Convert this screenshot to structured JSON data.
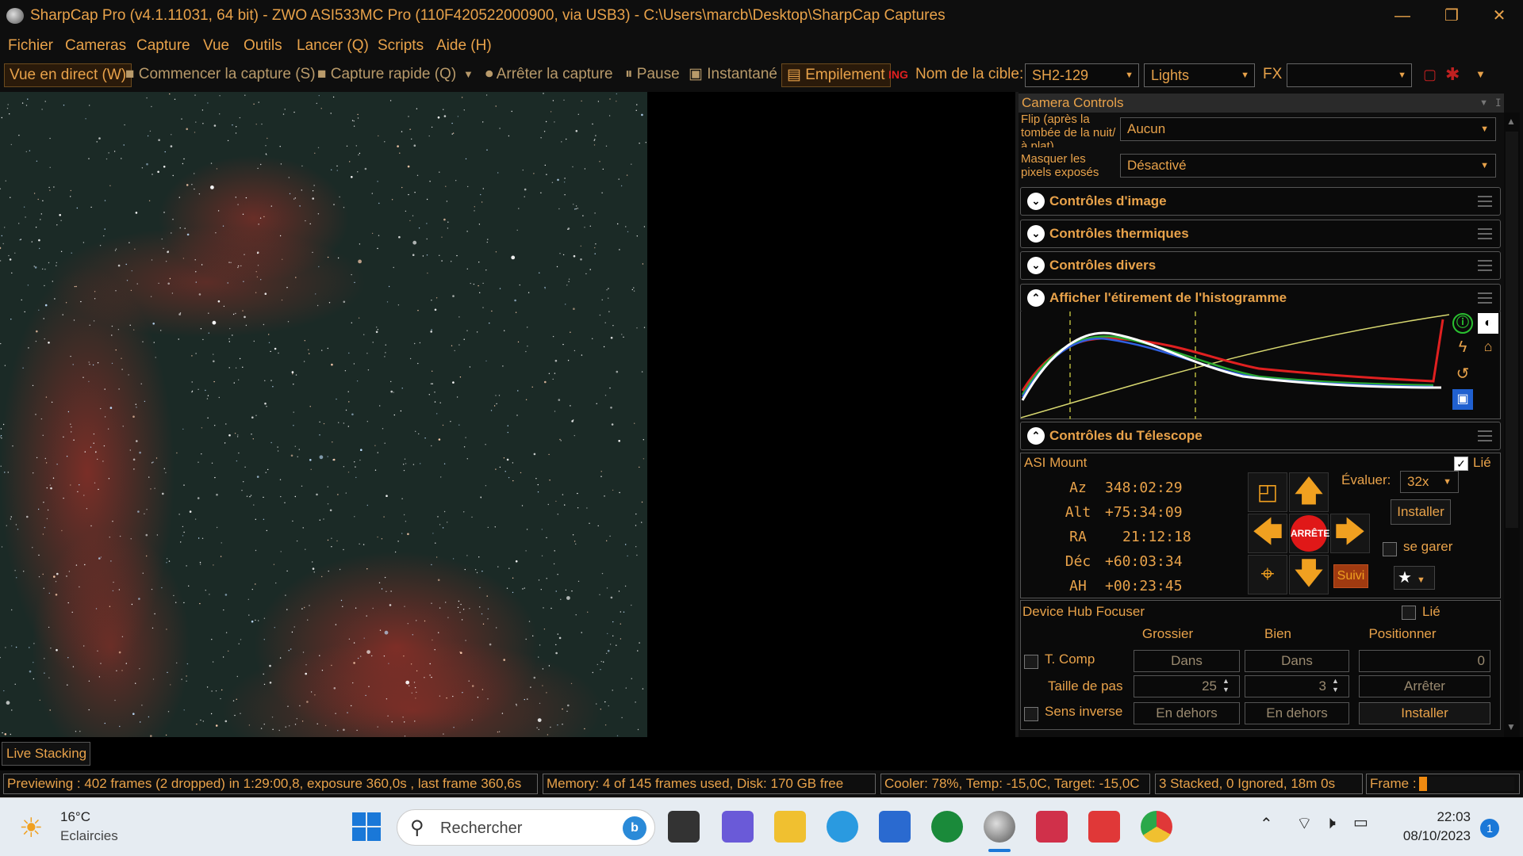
{
  "window": {
    "title": "SharpCap Pro (v4.1.11031, 64 bit) - ZWO ASI533MC Pro (110F420522000900, via USB3) - C:\\Users\\marcb\\Desktop\\SharpCap Captures",
    "minimize": "—",
    "restore": "❐",
    "close": "✕"
  },
  "menu": [
    "Fichier",
    "Cameras",
    "Capture",
    "Vue",
    "Outils",
    "Lancer (Q)",
    "Scripts",
    "Aide (H)"
  ],
  "toolbar": {
    "live_view": "Vue en direct (W)",
    "start_capture": "Commencer la capture (S)",
    "quick_capture": "Capture rapide (Q)",
    "stop_capture": "Arrêter la capture",
    "pause": "Pause",
    "snapshot": "Instantané",
    "stacking": "Empilement",
    "target_label": "Nom de la cible:",
    "target_value": "SH2-129",
    "frame_type": "Lights",
    "fx_label": "FX",
    "fx_value": ""
  },
  "panel": {
    "header": "Camera Controls",
    "flip_label": "Flip (après la tombée de la nuit/à plat)",
    "flip_value": "Aucun",
    "mask_label": "Masquer les pixels exposés",
    "mask_value": "Désactivé",
    "sections": {
      "image": "Contrôles d'image",
      "thermal": "Contrôles thermiques",
      "misc": "Contrôles divers",
      "histogram": "Afficher l'étirement de l'histogramme",
      "telescope": "Contrôles du Télescope"
    }
  },
  "telescope": {
    "mount": "ASI Mount",
    "linked_label": "Lié",
    "linked": true,
    "rows": [
      {
        "k": "Az",
        "v": "348:02:29"
      },
      {
        "k": "Alt",
        "v": "+75:34:09"
      },
      {
        "k": "RA",
        "v": "21:12:18"
      },
      {
        "k": "Déc",
        "v": "+60:03:34"
      },
      {
        "k": "AH",
        "v": "+00:23:45"
      }
    ],
    "stop_label": "ARRÊTE",
    "rate_label": "Évaluer:",
    "rate_value": "32x",
    "install_label": "Installer",
    "park_label": "se garer",
    "track_label": "Suivi"
  },
  "focuser": {
    "name": "Device Hub Focuser",
    "linked_label": "Lié",
    "col_coarse": "Grossier",
    "col_fine": "Bien",
    "col_position": "Positionner",
    "tcomp_label": "T. Comp",
    "in_label": "Dans",
    "position_value": "0",
    "step_label": "Taille de pas",
    "coarse_step": "25",
    "fine_step": "3",
    "stop_label": "Arrêter",
    "reverse_label": "Sens inverse",
    "out_label": "En dehors",
    "install_label": "Installer"
  },
  "live_stacking_tab": "Live Stacking",
  "status": {
    "preview": "Previewing : 402 frames (2 dropped) in 1:29:00,8, exposure 360,0s , last frame 360,6s",
    "memory": "Memory: 4 of 145 frames used, Disk: 170 GB free",
    "cooler": "Cooler: 78%, Temp: -15,0C, Target: -15,0C",
    "stacked": "3 Stacked, 0 Ignored, 18m 0s",
    "frame_label": "Frame :"
  },
  "taskbar": {
    "weather_temp": "16°C",
    "weather_desc": "Eclaircies",
    "search_placeholder": "Rechercher",
    "time": "22:03",
    "date": "08/10/2023",
    "notif_count": "1"
  },
  "colors": {
    "accent": "#e8a24a",
    "panel_bg": "#0e0e0e",
    "nebula": "#c83228"
  }
}
